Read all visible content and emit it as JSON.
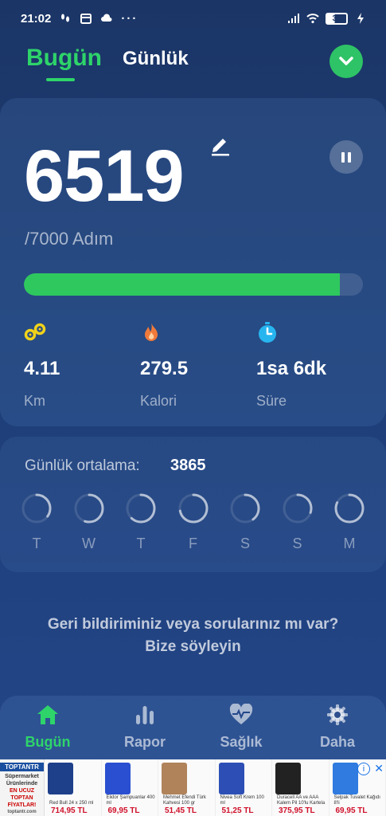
{
  "status_bar": {
    "time": "21:02",
    "battery": "39",
    "left_icons": [
      "footsteps-icon",
      "calendar-icon",
      "cloud-icon",
      "more-dots-icon"
    ],
    "right_icons": [
      "signal-icon",
      "wifi-icon",
      "battery-icon",
      "charging-icon"
    ]
  },
  "header": {
    "tab_today": "Bugün",
    "tab_daily": "Günlük",
    "dropdown_icon": "chevron-down-icon",
    "accent_color": "#2ed46a"
  },
  "steps": {
    "value": "6519",
    "goal_text": "/7000 Adım",
    "progress_fraction": 0.931,
    "edit_icon": "pencil-icon",
    "pause_icon": "pause-icon"
  },
  "metrics": [
    {
      "value": "4.11",
      "label": "Km",
      "icon": "distance-icon",
      "color": "#f0d21a"
    },
    {
      "value": "279.5",
      "label": "Kalori",
      "icon": "flame-icon",
      "color": "#f07a3a"
    },
    {
      "value": "1sa 6dk",
      "label": "Süre",
      "icon": "stopwatch-icon",
      "color": "#27b5f0"
    }
  ],
  "weekly": {
    "average_label": "Günlük ortalama:",
    "average_value": "3865",
    "days": [
      {
        "label": "T",
        "progress": 0.35
      },
      {
        "label": "W",
        "progress": 0.55
      },
      {
        "label": "T",
        "progress": 0.62
      },
      {
        "label": "F",
        "progress": 0.72
      },
      {
        "label": "S",
        "progress": 0.4
      },
      {
        "label": "S",
        "progress": 0.3
      },
      {
        "label": "M",
        "progress": 0.82
      }
    ]
  },
  "feedback": {
    "line1": "Geri bildiriminiz veya sorularınız mı var?",
    "line2": "Bize söyleyin"
  },
  "bottom_nav": [
    {
      "label": "Bugün",
      "icon": "home-icon",
      "active": true
    },
    {
      "label": "Rapor",
      "icon": "bar-chart-icon",
      "active": false
    },
    {
      "label": "Sağlık",
      "icon": "heart-pulse-icon",
      "active": false
    },
    {
      "label": "Daha",
      "icon": "gear-icon",
      "active": false
    }
  ],
  "ad": {
    "brand_name": "TOPTANTR",
    "brand_lines": [
      "Süpermarket",
      "Ürünlerinde",
      "EN UCUZ TOPTAN",
      "FİYATLAR!"
    ],
    "brand_site": "toptantr.com",
    "products": [
      {
        "name": "Red Bull 24 x 250 ml",
        "price": "714,95 TL",
        "color": "#1e3f8a"
      },
      {
        "name": "Elidor Şampuanlar 400 ml",
        "price": "69,95 TL",
        "color": "#2a4fd0"
      },
      {
        "name": "Mehmet Efendi Türk Kahvesi 100 gr",
        "price": "51,45 TL",
        "color": "#b0835a"
      },
      {
        "name": "Nivea Soft Krem 100 ml",
        "price": "51,25 TL",
        "color": "#2d4fb5"
      },
      {
        "name": "Duracell AA ve AAA Kalem Pil 10'lu Kartela",
        "price": "375,95 TL",
        "color": "#222222"
      },
      {
        "name": "Selpak Tuvalet Kağıdı 8'li",
        "price": "69,95 TL",
        "color": "#2f7be0"
      }
    ],
    "info_icon": "info-icon",
    "close_icon": "close-icon"
  }
}
